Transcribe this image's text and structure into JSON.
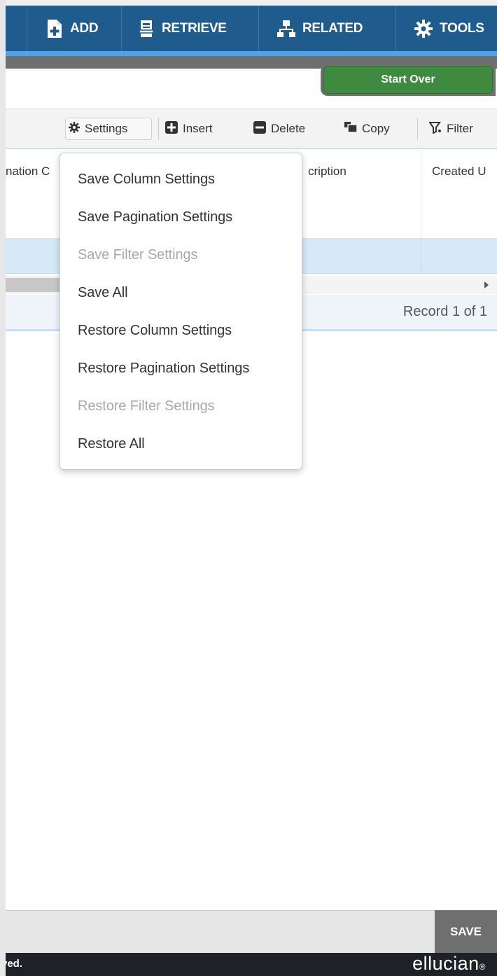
{
  "toolbar": {
    "add_label": "ADD",
    "retrieve_label": "RETRIEVE",
    "related_label": "RELATED",
    "tools_label": "TOOLS"
  },
  "start_over_label": "Start Over",
  "grid_toolbar": {
    "settings_label": "Settings",
    "insert_label": "Insert",
    "delete_label": "Delete",
    "copy_label": "Copy",
    "filter_label": "Filter"
  },
  "grid": {
    "columns": [
      "nation C",
      "cription",
      "Created U"
    ]
  },
  "pager": {
    "record_text": "Record 1 of 1"
  },
  "settings_menu": {
    "items": [
      {
        "label": "Save Column Settings",
        "enabled": true
      },
      {
        "label": "Save Pagination Settings",
        "enabled": true
      },
      {
        "label": "Save Filter Settings",
        "enabled": false
      },
      {
        "label": "Save All",
        "enabled": true
      },
      {
        "label": "Restore Column Settings",
        "enabled": true
      },
      {
        "label": "Restore Pagination Settings",
        "enabled": true
      },
      {
        "label": "Restore Filter Settings",
        "enabled": false
      },
      {
        "label": "Restore All",
        "enabled": true
      }
    ]
  },
  "footer": {
    "save_label": "SAVE",
    "copyright_fragment": "ved.",
    "brand": "ellucian",
    "brand_mark": "®"
  },
  "colors": {
    "toolbar_bg": "#1f5b8c",
    "toolbar_accent": "#4aa3f0",
    "start_over_green": "#3e8a3e",
    "selected_row": "#d6e9f7",
    "footer_dark": "#1e2228"
  },
  "icons": [
    "add-document-icon",
    "retrieve-icon",
    "related-icon",
    "tools-gear-icon",
    "settings-gear-icon",
    "insert-plus-icon",
    "delete-minus-icon",
    "copy-icon",
    "filter-icon",
    "scroll-right-arrow-icon"
  ]
}
